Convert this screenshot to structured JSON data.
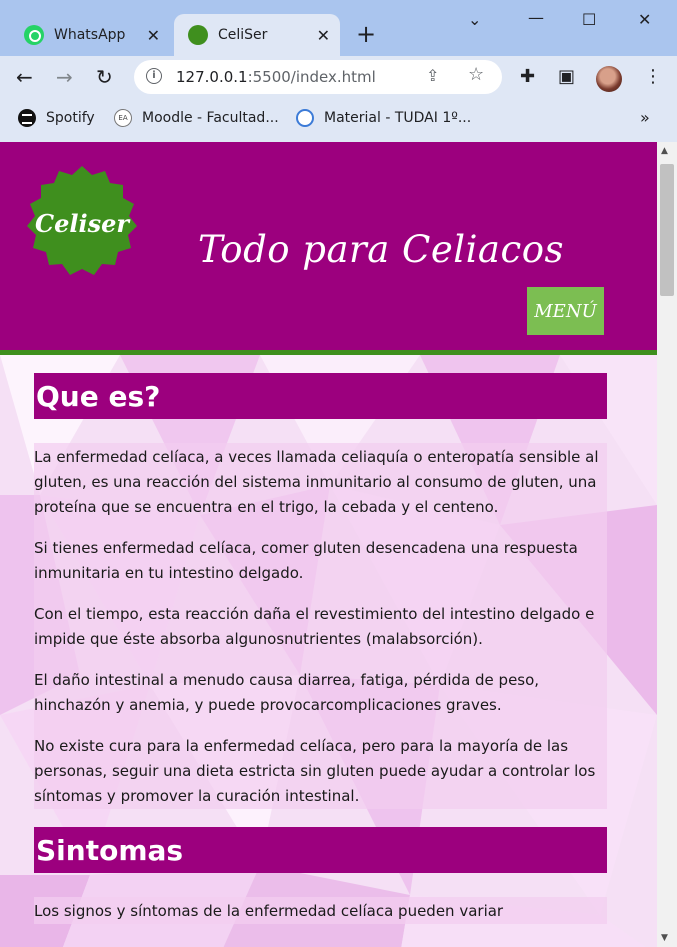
{
  "browser": {
    "tabs": [
      {
        "title": "WhatsApp",
        "active": false,
        "favicon": "whatsapp-icon"
      },
      {
        "title": "CeliSer",
        "active": true,
        "favicon": "celiser-icon"
      }
    ],
    "new_tab_symbol": "+",
    "url_host": "127.0.0.1",
    "url_rest": ":5500/index.html",
    "bookmarks": [
      {
        "label": "Spotify",
        "icon": "spotify-icon"
      },
      {
        "label": "Moodle - Facultad...",
        "icon": "moodle-icon",
        "icon_text": "EA"
      },
      {
        "label": "Material - TUDAI 1º...",
        "icon": "document-icon"
      }
    ],
    "bookmarks_more": "»"
  },
  "site": {
    "logo_text": "Celiser",
    "title": "Todo para Celiacos",
    "menu_label": "MENÚ",
    "colors": {
      "brand_purple": "#9c007e",
      "brand_green": "#3f8f1e",
      "menu_green": "#7cbe52"
    }
  },
  "sections": [
    {
      "heading": "Que es?",
      "paragraphs": [
        "La enfermedad celíaca, a veces llamada celiaquía o enteropatía sensible al gluten, es una reacción del sistema inmunitario al consumo de gluten, una proteína que se encuentra en el trigo, la cebada y el centeno.",
        "Si tienes enfermedad celíaca, comer gluten desencadena una respuesta inmunitaria en tu intestino delgado.",
        "Con el tiempo, esta reacción daña el revestimiento del intestino delgado e impide que éste absorba algunosnutrientes (malabsorción).",
        "El daño intestinal a menudo causa diarrea, fatiga, pérdida de peso, hinchazón y anemia, y puede provocarcomplicaciones graves.",
        "No existe cura para la enfermedad celíaca, pero para la mayoría de las personas, seguir una dieta estricta sin gluten puede ayudar a controlar los síntomas y promover la curación intestinal."
      ]
    },
    {
      "heading": "Sintomas",
      "paragraphs": [
        "Los signos y síntomas de la enfermedad celíaca pueden variar"
      ]
    }
  ]
}
